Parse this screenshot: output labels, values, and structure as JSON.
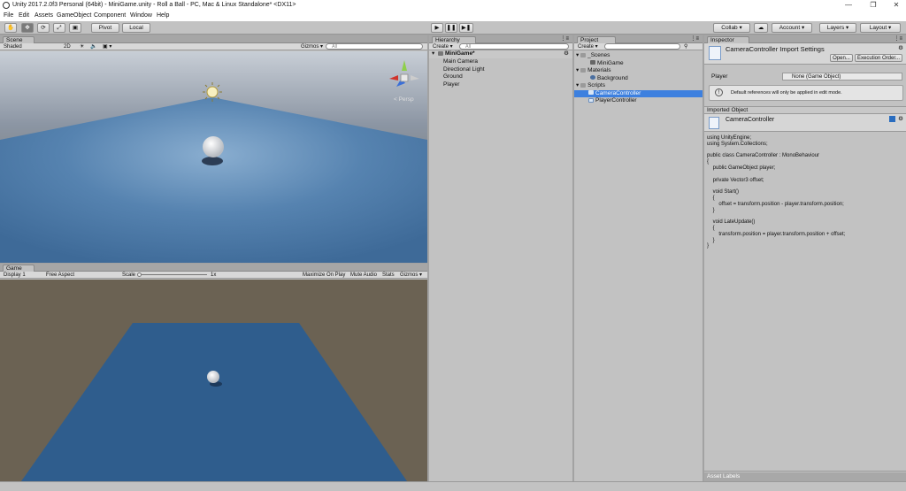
{
  "window": {
    "title": "Unity 2017.2.0f3 Personal (64bit) - MiniGame.unity - Roll a Ball - PC, Mac & Linux Standalone* <DX11>",
    "minimize": "—",
    "maximize": "❐",
    "close": "✕"
  },
  "menu": [
    "File",
    "Edit",
    "Assets",
    "GameObject",
    "Component",
    "Window",
    "Help"
  ],
  "toolbar": {
    "tools": [
      "✋",
      "✥",
      "⟳",
      "⤢",
      "▣"
    ],
    "pivot": "Pivot",
    "local": "Local",
    "play": "▶",
    "pause": "❚❚",
    "step": "▶❚",
    "collab": "Collab ▾",
    "cloud": "☁",
    "account": "Account ▾",
    "layers": "Layers ▾",
    "layout": "Layout ▾"
  },
  "scene": {
    "tab": "Scene",
    "shaded": "Shaded",
    "mode2d": "2D",
    "light": "☀",
    "audio": "🔈",
    "fx": "▣ ▾",
    "gizmos": "Gizmos ▾",
    "search_placeholder": "All",
    "persp": "< Persp"
  },
  "game": {
    "tab": "Game",
    "display": "Display 1",
    "aspect": "Free Aspect",
    "scale_label": "Scale",
    "scale_value": "1x",
    "max_on_play": "Maximize On Play",
    "mute": "Mute Audio",
    "stats": "Stats",
    "gizmos": "Gizmos ▾"
  },
  "hierarchy": {
    "tab": "Hierarchy",
    "create": "Create ▾",
    "search_placeholder": "All",
    "scene_name": "MiniGame*",
    "items": [
      "Main Camera",
      "Directional Light",
      "Ground",
      "Player"
    ]
  },
  "project": {
    "tab": "Project",
    "create": "Create ▾",
    "items": [
      {
        "label": "_Scenes",
        "level": 0
      },
      {
        "label": "MiniGame",
        "level": 1
      },
      {
        "label": "Materials",
        "level": 0
      },
      {
        "label": "Background",
        "level": 1
      },
      {
        "label": "Scripts",
        "level": 0
      },
      {
        "label": "CameraController",
        "level": 1
      },
      {
        "label": "PlayerController",
        "level": 1
      }
    ],
    "selected": "CameraController"
  },
  "inspector": {
    "tab": "Inspector",
    "title": "CameraController Import Settings",
    "open": "Open...",
    "exec_order": "Execution Order...",
    "player_label": "Player",
    "player_value": "None (Game Object)",
    "info": "Default references will only be applied in edit mode.",
    "imported_object": "Imported Object",
    "object_name": "CameraController",
    "code": "using UnityEngine;\nusing System.Collections;\n\npublic class CameraController : MonoBehaviour\n{\n    public GameObject player;\n\n    private Vector3 offset;\n\n    void Start()\n    {\n        offset = transform.position - player.transform.position;\n    }\n\n    void LateUpdate()\n    {\n        transform.position = player.transform.position + offset;\n    }\n}",
    "asset_labels": "Asset Labels"
  },
  "colors": {
    "selection": "#3d80df",
    "panel": "#c2c2c2",
    "sky_top": "#9aa5b5",
    "ground": "#6b6253",
    "plane": "#2f5d8d"
  }
}
